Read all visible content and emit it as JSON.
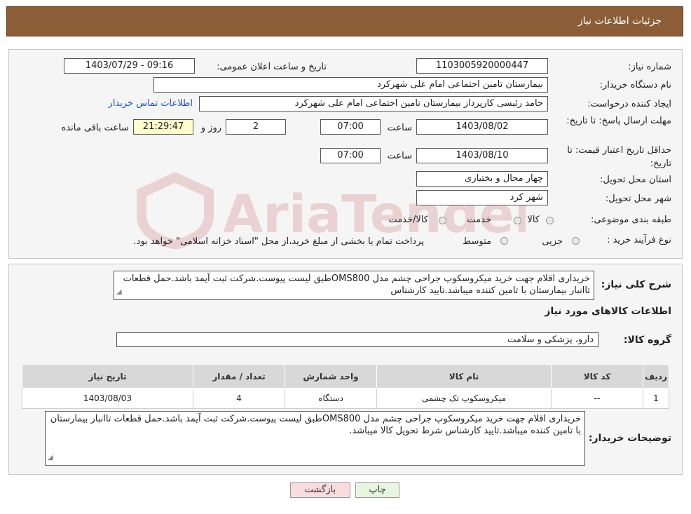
{
  "header": {
    "title": "جزئیات اطلاعات نیاز"
  },
  "form": {
    "need_number_label": "شماره نیاز:",
    "need_number": "1103005920000447",
    "announce_label": "تاریخ و ساعت اعلان عمومی:",
    "announce_value": "1403/07/29 - 09:16",
    "buyer_org_label": "نام دستگاه خریدار:",
    "buyer_org": "بیمارستان تامین اجتماعی امام علی شهرکرد",
    "requester_label": "ایجاد کننده درخواست:",
    "requester": "حامد رئیسی کارپرداز بیمارستان تامین اجتماعی امام علی شهرکرد",
    "contact_link": "اطلاعات تماس خریدار",
    "reply_deadline_label": "مهلت ارسال پاسخ: تا تاریخ:",
    "reply_date": "1403/08/02",
    "time_label": "ساعت",
    "reply_time": "07:00",
    "days_value": "2",
    "days_label": "روز و",
    "remaining_time": "21:29:47",
    "remaining_label": "ساعت باقی مانده",
    "validity_label": "حداقل تاریخ اعتبار قیمت: تا تاریخ:",
    "validity_date": "1403/08/10",
    "validity_time": "07:00",
    "province_label": "استان محل تحویل:",
    "province": "چهار محال و بختیاری",
    "city_label": "شهر محل تحویل:",
    "city": "شهر کرد",
    "category_label": "طبقه بندی موضوعی:",
    "category_options": [
      "کالا",
      "خدمت",
      "کالا/خدمت"
    ],
    "process_label": "نوع فرآیند خرید :",
    "process_options": [
      "جزیی",
      "متوسط"
    ],
    "process_note": "پرداخت تمام یا بخشی از مبلغ خرید،از محل \"اسناد خزانه اسلامی\" خواهد بود."
  },
  "summary": {
    "label": "شرح کلی نیاز:",
    "text": "خریداری اقلام جهت خرید میکروسکوپ جراحی چشم مدل OMS800طبق لیست پیوست.شرکت ثبت آیمد باشد.حمل قطعات تاانبار بیمارستان با تامین کننده میباشد.تایید کارشناس"
  },
  "goods": {
    "section_title": "اطلاعات کالاهای مورد نیاز",
    "group_label": "گروه کالا:",
    "group_value": "دارو، پزشکی و سلامت",
    "columns": [
      "ردیف",
      "کد کالا",
      "نام کالا",
      "واحد شمارش",
      "تعداد / مقدار",
      "تاریخ نیاز"
    ],
    "rows": [
      {
        "row": "1",
        "code": "--",
        "name": "میکروسکوپ تک چشمی",
        "unit": "دستگاه",
        "qty": "4",
        "date": "1403/08/03"
      }
    ]
  },
  "buyer_notes": {
    "label": "توضیحات خریدار:",
    "text": "خریداری اقلام جهت خرید میکروسکوپ جراحی چشم مدل OMS800طبق لیست پیوست.شرکت ثبت آیمد باشد.حمل قطعات تاانبار بیمارستان با تامین کننده میباشد.تایید کارشناس شرط تحویل کالا میباشد."
  },
  "buttons": {
    "print": "چاپ",
    "back": "بازگشت"
  },
  "watermark": {
    "text": "AriaTender.net",
    "color": "#b22222"
  }
}
